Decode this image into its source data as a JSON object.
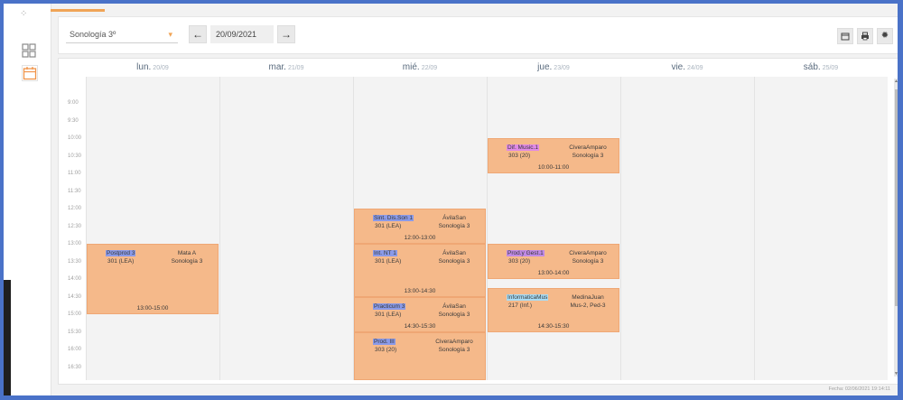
{
  "toolbar": {
    "group_select": "Sonología 3º",
    "date": "20/09/2021",
    "prev_icon": "arrow-left-icon",
    "next_icon": "arrow-right-icon",
    "calendar_icon": "calendar-icon",
    "print_icon": "print-icon",
    "settings_icon": "gear-icon"
  },
  "days": [
    {
      "name": "lun.",
      "date": "20/09"
    },
    {
      "name": "mar.",
      "date": "21/09"
    },
    {
      "name": "mié.",
      "date": "22/09"
    },
    {
      "name": "jue.",
      "date": "23/09"
    },
    {
      "name": "vie.",
      "date": "24/09"
    },
    {
      "name": "sáb.",
      "date": "25/09"
    }
  ],
  "times": [
    "9:00",
    "9:30",
    "10:00",
    "10:30",
    "11:00",
    "11:30",
    "12:00",
    "12:30",
    "13:00",
    "13:30",
    "14:00",
    "14:30",
    "15:00",
    "15:30",
    "16:00",
    "16:30"
  ],
  "events": [
    {
      "day": 0,
      "start": 13.0,
      "end": 15.0,
      "subject": "Postprod 3",
      "subject_bg": "#8a9ae8",
      "room": "301 (LEA)",
      "prof": "Mata A",
      "group": "Sonología 3",
      "time": "13:00-15:00"
    },
    {
      "day": 2,
      "start": 12.0,
      "end": 13.0,
      "subject": "Sint. Dis.Son 1",
      "subject_bg": "#8a9ae8",
      "room": "301 (LEA)",
      "prof": "ÁvilaSan",
      "group": "Sonología 3",
      "time": "12:00-13:00"
    },
    {
      "day": 2,
      "start": 13.0,
      "end": 14.5,
      "subject": "Int. NT 1",
      "subject_bg": "#8a9ae8",
      "room": "301 (LEA)",
      "prof": "ÁvilaSan",
      "group": "Sonología 3",
      "time": "13:00-14:30"
    },
    {
      "day": 2,
      "start": 14.5,
      "end": 15.5,
      "subject": "Practicum 3",
      "subject_bg": "#8a9ae8",
      "room": "301 (LEA)",
      "prof": "ÁvilaSan",
      "group": "Sonología 3",
      "time": "14:30-15:30"
    },
    {
      "day": 2,
      "start": 15.5,
      "end": 17.25,
      "subject": "Prod. III",
      "subject_bg": "#8a9ae8",
      "room": "303 (20)",
      "prof": "CiveraAmparo",
      "group": "Sonología 3",
      "time": ""
    },
    {
      "day": 3,
      "start": 10.0,
      "end": 11.0,
      "subject": "Dif. Music.1",
      "subject_bg": "#e08ae6",
      "room": "303 (20)",
      "prof": "CiveraAmparo",
      "group": "Sonología 3",
      "time": "10:00-11:00"
    },
    {
      "day": 3,
      "start": 13.0,
      "end": 14.0,
      "subject": "Prod.y Gest.1",
      "subject_bg": "#c08ae6",
      "room": "303 (20)",
      "prof": "CiveraAmparo",
      "group": "Sonología 3",
      "time": "13:00-14:00"
    },
    {
      "day": 3,
      "start": 14.25,
      "end": 15.5,
      "subject": "InformaticaMus",
      "subject_bg": "#a8dcf5",
      "room": "217 (Inf.)",
      "prof": "MedinaJuan",
      "group": "Mus-2, Ped-3",
      "time": "14:30-15:30"
    }
  ],
  "footer": "Fecha: 02/06/2021 19:14:11"
}
